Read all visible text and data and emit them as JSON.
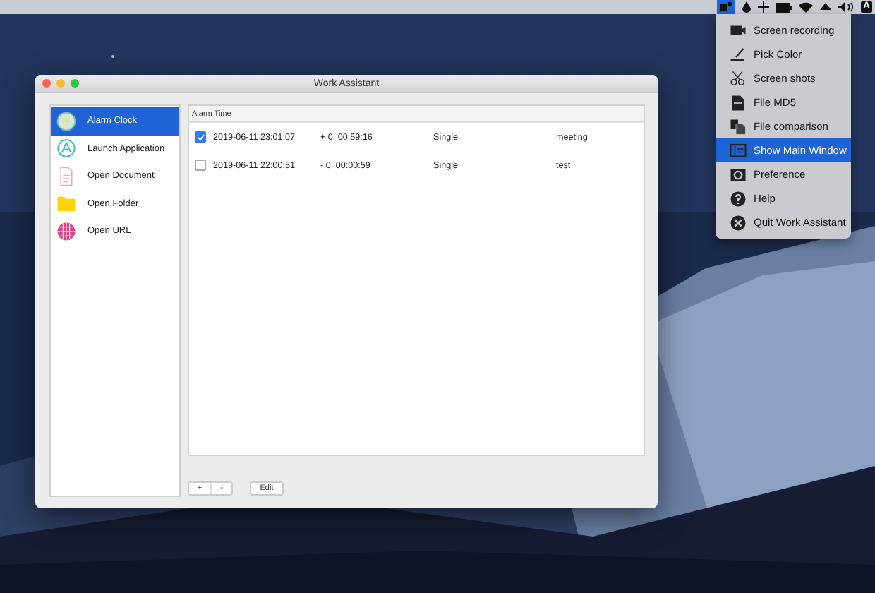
{
  "menubar": {
    "input_source": "A"
  },
  "status_menu": {
    "items": [
      {
        "label": "Screen recording",
        "kind": "record",
        "selected": false
      },
      {
        "label": "Pick Color",
        "kind": "pick",
        "selected": false
      },
      {
        "label": "Screen shots",
        "kind": "scissors",
        "selected": false
      },
      {
        "label": "File MD5",
        "kind": "md5",
        "selected": false
      },
      {
        "label": "File comparison",
        "kind": "compare",
        "selected": false
      },
      {
        "label": "Show Main Window",
        "kind": "window",
        "selected": true
      },
      {
        "label": "Preference",
        "kind": "gear",
        "selected": false
      },
      {
        "label": "Help",
        "kind": "help",
        "selected": false
      },
      {
        "label": "Quit Work Assistant",
        "kind": "quit",
        "selected": false
      }
    ]
  },
  "window": {
    "title": "Work Assistant"
  },
  "sidebar": {
    "items": [
      {
        "label": "Alarm Clock",
        "kind": "clock",
        "selected": true
      },
      {
        "label": "Launch Application",
        "kind": "app",
        "selected": false
      },
      {
        "label": "Open Document",
        "kind": "document",
        "selected": false
      },
      {
        "label": "Open Folder",
        "kind": "folder",
        "selected": false
      },
      {
        "label": "Open URL",
        "kind": "globe",
        "selected": false
      }
    ]
  },
  "table": {
    "columns": [
      "Alarm Time"
    ],
    "rows": [
      {
        "checked": true,
        "time": "2019-06-11 23:01:07",
        "remaining": "+ 0: 00:59:16",
        "repeat": "Single",
        "note": "meeting"
      },
      {
        "checked": false,
        "time": "2019-06-11 22:00:51",
        "remaining": "- 0: 00:00:59",
        "repeat": "Single",
        "note": "test"
      }
    ]
  },
  "buttons": {
    "add": "+",
    "remove": "-",
    "edit": "Edit"
  }
}
